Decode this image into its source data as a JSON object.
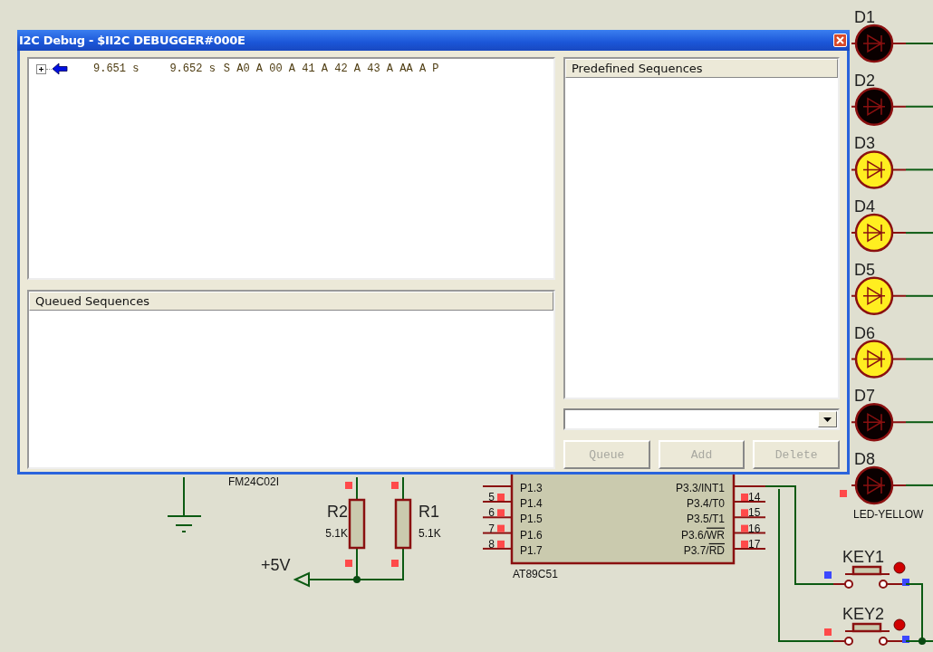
{
  "dialog": {
    "title": "I2C Debug - $II2C DEBUGGER#000E",
    "log_rows": [
      {
        "expanded": false,
        "start": "9.651 s",
        "end": "9.652 s",
        "sequence": "S A0 A 00 A 41 A 42 A 43 A AA A P"
      }
    ],
    "queued_panel": {
      "header": "Queued Sequences"
    },
    "predefined_panel": {
      "header": "Predefined Sequences"
    },
    "buttons": [
      {
        "label": "Queue",
        "disabled": true
      },
      {
        "label": "Add",
        "disabled": true
      },
      {
        "label": "Delete",
        "disabled": true
      }
    ]
  },
  "schematic": {
    "leds": [
      {
        "label": "D1",
        "lit": false
      },
      {
        "label": "D2",
        "lit": false
      },
      {
        "label": "D3",
        "lit": true
      },
      {
        "label": "D4",
        "lit": true
      },
      {
        "label": "D5",
        "lit": true
      },
      {
        "label": "D6",
        "lit": true
      },
      {
        "label": "D7",
        "lit": false
      },
      {
        "label": "D8",
        "lit": false
      }
    ],
    "led_part": "LED-YELLOW",
    "keys": [
      {
        "label": "KEY1"
      },
      {
        "label": "KEY2"
      }
    ],
    "resistors": [
      {
        "label": "R2",
        "value": "5.1K"
      },
      {
        "label": "R1",
        "value": "5.1K"
      }
    ],
    "power_label": "+5V",
    "eeprom_part": "FM24C02I",
    "chip": {
      "name": "AT89C51",
      "left_pins": [
        {
          "number": "5",
          "name": "P1.4"
        },
        {
          "number": "6",
          "name": "P1.5"
        },
        {
          "number": "7",
          "name": "P1.6"
        },
        {
          "number": "8",
          "name": "P1.7"
        }
      ],
      "left_first": {
        "name": "P1.3"
      },
      "right_first": {
        "name": "P3.3/INT1"
      },
      "right_pins": [
        {
          "number": "14",
          "name": "P3.4/T0"
        },
        {
          "number": "15",
          "name": "P3.5/T1"
        },
        {
          "number": "16",
          "name": "P3.6/",
          "negated": "WR"
        },
        {
          "number": "17",
          "name": "P3.7/",
          "negated": "RD"
        }
      ]
    }
  }
}
